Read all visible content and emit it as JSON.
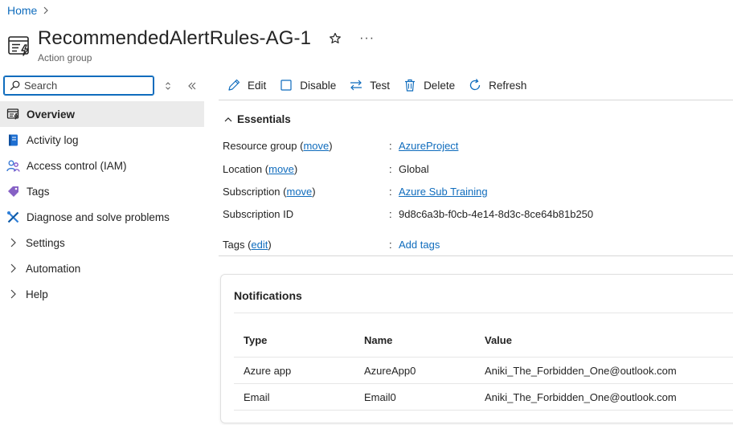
{
  "breadcrumb": {
    "home": "Home"
  },
  "header": {
    "title": "RecommendedAlertRules-AG-1",
    "subtitle": "Action group",
    "more": "···"
  },
  "search": {
    "placeholder": "Search"
  },
  "nav": {
    "items": [
      {
        "label": "Overview",
        "icon": "overview-icon"
      },
      {
        "label": "Activity log",
        "icon": "activity-log-icon"
      },
      {
        "label": "Access control (IAM)",
        "icon": "iam-icon"
      },
      {
        "label": "Tags",
        "icon": "tag-icon"
      },
      {
        "label": "Diagnose and solve problems",
        "icon": "wrench-icon"
      },
      {
        "label": "Settings",
        "icon": "chevron-right-icon"
      },
      {
        "label": "Automation",
        "icon": "chevron-right-icon"
      },
      {
        "label": "Help",
        "icon": "chevron-right-icon"
      }
    ]
  },
  "toolbar": {
    "edit": "Edit",
    "disable": "Disable",
    "test": "Test",
    "delete": "Delete",
    "refresh": "Refresh"
  },
  "essentials": {
    "heading": "Essentials",
    "move": "move",
    "edit": "edit",
    "resource_group_label": "Resource group",
    "resource_group_value": "AzureProject",
    "location_label": "Location",
    "location_value": "Global",
    "subscription_label": "Subscription",
    "subscription_value": "Azure Sub Training",
    "subscription_id_label": "Subscription ID",
    "subscription_id_value": "9d8c6a3b-f0cb-4e14-8d3c-8ce64b81b250",
    "tags_label": "Tags",
    "tags_value": "Add tags"
  },
  "notifications": {
    "title": "Notifications",
    "columns": [
      "Type",
      "Name",
      "Value"
    ],
    "rows": [
      {
        "type": "Azure app",
        "name": "AzureApp0",
        "value": "Aniki_The_Forbidden_One@outlook.com"
      },
      {
        "type": "Email",
        "name": "Email0",
        "value": "Aniki_The_Forbidden_One@outlook.com"
      }
    ]
  },
  "colors": {
    "accent": "#0f6cbd",
    "active_nav_bg": "#ebebeb"
  }
}
